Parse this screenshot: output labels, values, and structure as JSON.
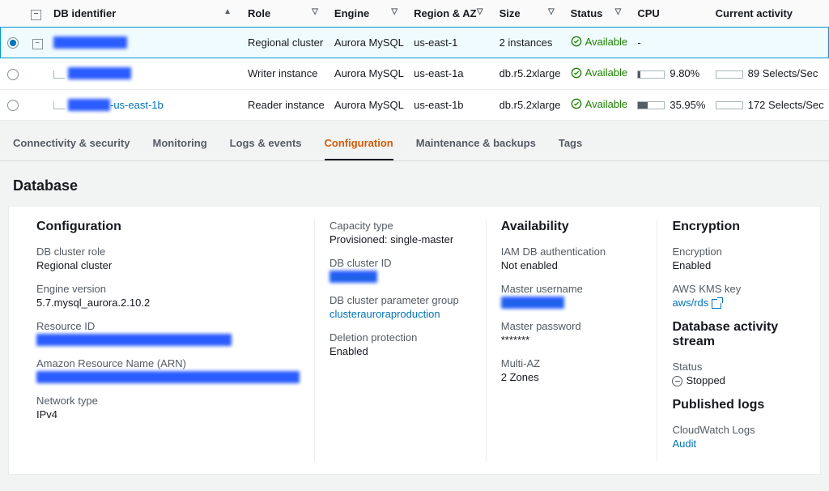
{
  "table": {
    "headers": {
      "id": "DB identifier",
      "role": "Role",
      "engine": "Engine",
      "region": "Region & AZ",
      "size": "Size",
      "status": "Status",
      "cpu": "CPU",
      "activity": "Current activity"
    },
    "rows": [
      {
        "id_redacted": "xxxxxxxxxxxxxx",
        "role": "Regional cluster",
        "engine": "Aurora MySQL",
        "region": "us-east-1",
        "size": "2 instances",
        "status": "Available",
        "cpu": "-",
        "cpu_pct": null,
        "activity": "",
        "selected": true,
        "expanded": true,
        "indent": 0
      },
      {
        "id_redacted": "xxxxxxxxxxxx",
        "role": "Writer instance",
        "engine": "Aurora MySQL",
        "region": "us-east-1a",
        "size": "db.r5.2xlarge",
        "status": "Available",
        "cpu": "9.80%",
        "cpu_pct": 9.8,
        "activity": "89 Selects/Sec",
        "selected": false,
        "indent": 1
      },
      {
        "id_redacted": "xxxxxxxx",
        "id_suffix": "-us-east-1b",
        "role": "Reader instance",
        "engine": "Aurora MySQL",
        "region": "us-east-1b",
        "size": "db.r5.2xlarge",
        "status": "Available",
        "cpu": "35.95%",
        "cpu_pct": 35.95,
        "activity": "172 Selects/Sec",
        "selected": false,
        "indent": 1
      }
    ]
  },
  "tabs": [
    {
      "label": "Connectivity & security",
      "active": false
    },
    {
      "label": "Monitoring",
      "active": false
    },
    {
      "label": "Logs & events",
      "active": false
    },
    {
      "label": "Configuration",
      "active": true
    },
    {
      "label": "Maintenance & backups",
      "active": false
    },
    {
      "label": "Tags",
      "active": false
    }
  ],
  "detail": {
    "title": "Database",
    "configuration": {
      "heading": "Configuration",
      "db_cluster_role_label": "DB cluster role",
      "db_cluster_role": "Regional cluster",
      "engine_version_label": "Engine version",
      "engine_version": "5.7.mysql_aurora.2.10.2",
      "resource_id_label": "Resource ID",
      "resource_id_redacted": "xxxxxxxxxxxxxxxxxxxxxxxxxxxxxxxxxxxxx",
      "arn_label": "Amazon Resource Name (ARN)",
      "arn_redacted": "xxxxxxxxxxxxxxxxxxxxxxxxxxxxxxxxxxxxxxxxxxxxxxxxxx",
      "network_type_label": "Network type",
      "network_type": "IPv4"
    },
    "capacity": {
      "capacity_type_label": "Capacity type",
      "capacity_type": "Provisioned: single-master",
      "cluster_id_label": "DB cluster ID",
      "cluster_id_redacted": "xxxxxxxxx",
      "param_group_label": "DB cluster parameter group",
      "param_group": "clusterauroraproduction",
      "deletion_label": "Deletion protection",
      "deletion": "Enabled"
    },
    "availability": {
      "heading": "Availability",
      "iam_label": "IAM DB authentication",
      "iam": "Not enabled",
      "master_user_label": "Master username",
      "master_user_redacted": "xxxxxxxxxxxx",
      "master_pw_label": "Master password",
      "master_pw": "*******",
      "multi_az_label": "Multi-AZ",
      "multi_az": "2 Zones"
    },
    "encryption": {
      "heading": "Encryption",
      "enc_label": "Encryption",
      "enc": "Enabled",
      "kms_label": "AWS KMS key",
      "kms": "aws/rds",
      "activity_heading": "Database activity stream",
      "status_label": "Status",
      "status": "Stopped",
      "logs_heading": "Published logs",
      "cw_label": "CloudWatch Logs",
      "cw": "Audit"
    }
  }
}
